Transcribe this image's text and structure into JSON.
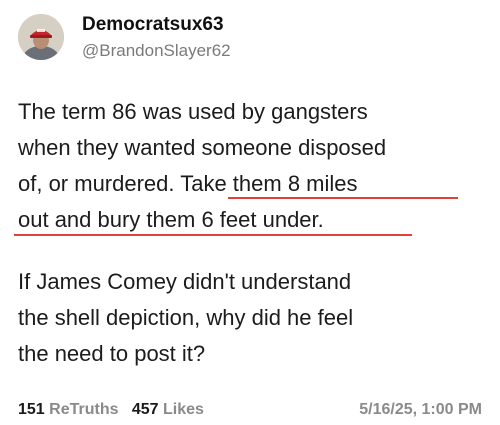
{
  "author": {
    "display_name": "Democratsux63",
    "handle": "@BrandonSlayer62",
    "avatar_icon": "user-avatar-red-cap"
  },
  "post": {
    "paragraph1_lines": [
      "The term 86 was used by gangsters",
      "when they wanted someone disposed",
      "of, or murdered. Take them 8 miles",
      "out and bury them 6 feet under."
    ],
    "paragraph2_lines": [
      "If James Comey didn't understand",
      "the shell depiction, why did he feel",
      "the need to post it?"
    ],
    "highlight_color": "#e0413b"
  },
  "stats": {
    "retruths_count": "151",
    "retruths_label": "ReTruths",
    "likes_count": "457",
    "likes_label": "Likes",
    "timestamp": "5/16/25, 1:00 PM"
  }
}
